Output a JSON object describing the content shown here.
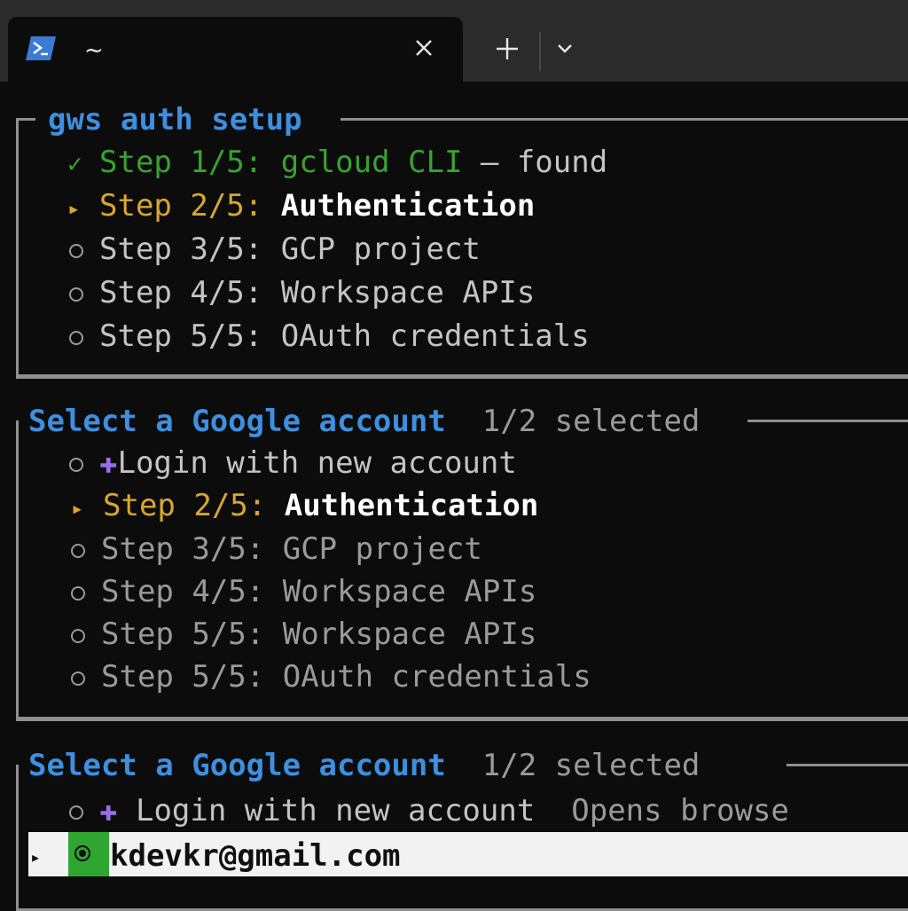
{
  "window": {
    "tab_title": "~",
    "colors": {
      "titlebar": "#2b2b2b",
      "terminal_bg": "#0c0c0c",
      "ps_icon": "#3a7bd5"
    },
    "icons": [
      "powershell-icon",
      "close-icon",
      "plus-icon",
      "chevron-down-icon"
    ]
  },
  "setup_panel": {
    "title": "gws auth setup",
    "steps": [
      {
        "mark": "✓",
        "label": "Step 1/5:",
        "value": "gcloud CLI",
        "suffix": " — found"
      },
      {
        "mark": "▸",
        "label": "Step 2/5:",
        "value": "Authentication"
      },
      {
        "label": "Step 3/5:",
        "value": "GCP project"
      },
      {
        "label": "Step 4/5:",
        "value": "Workspace APIs"
      },
      {
        "label": "Step 5/5:",
        "value": "OAuth credentials"
      }
    ]
  },
  "account_panel_1": {
    "title": "Select a Google account",
    "counter": "1/2 selected",
    "items": [
      {
        "glyph": "✚",
        "text": "Login with new account"
      },
      {
        "mark": "▸",
        "label": "Step 2/5:",
        "value": "Authentication"
      },
      {
        "label": "Step 3/5:",
        "value": "GCP project"
      },
      {
        "label": "Step 4/5:",
        "value": "Workspace APIs"
      },
      {
        "label": "Step 5/5:",
        "value": "Workspace APIs"
      },
      {
        "label": "Step 5/5:",
        "value": "OAuth credentials"
      }
    ]
  },
  "account_panel_2": {
    "title": "Select a Google account",
    "counter": "1/2 selected",
    "login_option": {
      "glyph": "✚",
      "text": "Login with new account",
      "hint": "Opens browse"
    },
    "selected_account": {
      "mark": "▸",
      "email": "kdevkr@gmail.com"
    }
  }
}
